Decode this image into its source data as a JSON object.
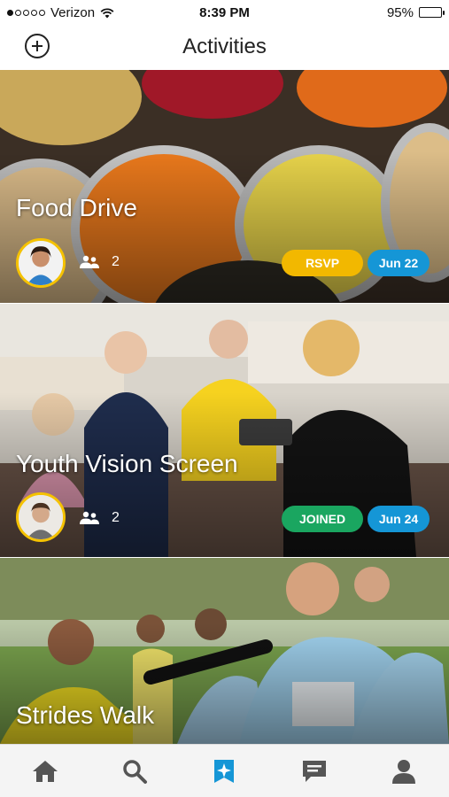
{
  "status_bar": {
    "carrier": "Verizon",
    "time": "8:39 PM",
    "battery_percent": "95%",
    "battery_level": 0.95,
    "signal_bars_filled": 1,
    "signal_bars_total": 5
  },
  "header": {
    "title": "Activities",
    "add_icon": "plus-circle-icon"
  },
  "activities": [
    {
      "title": "Food Drive",
      "member_count": "2",
      "status_label": "RSVP",
      "status_color": "#f2b800",
      "date": "Jun 22"
    },
    {
      "title": "Youth Vision Screen",
      "member_count": "2",
      "status_label": "JOINED",
      "status_color": "#1aa660",
      "date": "Jun 24"
    },
    {
      "title": "Strides Walk"
    }
  ],
  "tab_bar": {
    "items": [
      {
        "icon": "home-icon"
      },
      {
        "icon": "search-icon"
      },
      {
        "icon": "activities-icon",
        "active": true
      },
      {
        "icon": "chat-icon"
      },
      {
        "icon": "profile-icon"
      }
    ],
    "active_color": "#1596d6",
    "inactive_color": "#555555"
  },
  "colors": {
    "date_pill": "#1596d6",
    "avatar_border": "#f5c200"
  }
}
